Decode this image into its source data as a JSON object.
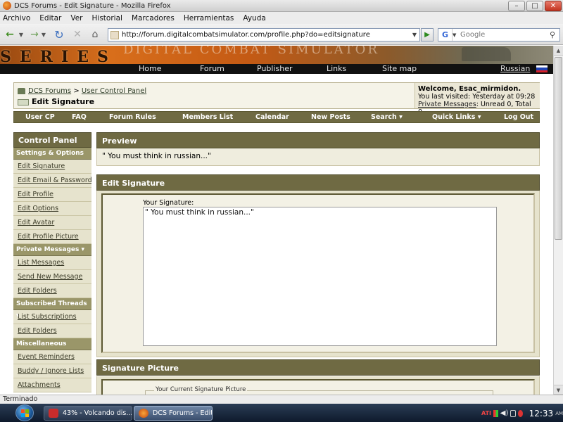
{
  "window": {
    "title": "DCS Forums - Edit Signature - Mozilla Firefox",
    "buttons": {
      "minimize": "–",
      "maximize": "□",
      "close": "✕"
    }
  },
  "menu": [
    "Archivo",
    "Editar",
    "Ver",
    "Historial",
    "Marcadores",
    "Herramientas",
    "Ayuda"
  ],
  "toolbar": {
    "url": "http://forum.digitalcombatsimulator.com/profile.php?do=editsignature",
    "search_placeholder": "Google",
    "search_engine_letter": "G",
    "icons": {
      "back": "←",
      "forward": "→",
      "reload": "↻",
      "stop": "✕",
      "home": "⌂",
      "dropdown": "▼",
      "go": "▶",
      "magnifier": "⚲"
    }
  },
  "banner": {
    "series_text": "SERIES",
    "dcs_text": "DIGITAL COMBAT SIMULATOR"
  },
  "top_nav": {
    "links": [
      "Home",
      "Forum",
      "Publisher",
      "Links",
      "Site map"
    ],
    "language": "Russian"
  },
  "breadcrumb": {
    "root": "DCS Forums",
    "separator": ">",
    "parent": "User Control Panel",
    "current": "Edit Signature"
  },
  "welcome": {
    "greeting": "Welcome, Esac_mirmidon.",
    "last_visited": "You last visited: Yesterday at 09:28",
    "pm_link": "Private Messages",
    "pm_counts": ": Unread 0, Total 0."
  },
  "nav_strip": [
    "User CP",
    "FAQ",
    "Forum Rules",
    "Members List",
    "Calendar",
    "New Posts",
    "Search ▾",
    "Quick Links ▾",
    "Log Out"
  ],
  "sidebar": {
    "title": "Control Panel",
    "sections": [
      {
        "title": "Settings & Options",
        "items": [
          "Edit Signature",
          "Edit Email & Password",
          "Edit Profile",
          "Edit Options",
          "Edit Avatar",
          "Edit Profile Picture"
        ]
      },
      {
        "title": "Private Messages ▾",
        "items": [
          "List Messages",
          "Send New Message",
          "Edit Folders"
        ]
      },
      {
        "title": "Subscribed Threads ▾",
        "items": [
          "List Subscriptions",
          "Edit Folders"
        ]
      },
      {
        "title": "Miscellaneous",
        "items": [
          "Event Reminders",
          "Buddy / Ignore Lists",
          "Attachments"
        ]
      }
    ]
  },
  "preview": {
    "title": "Preview",
    "text": "\" You must think in russian...\""
  },
  "edit_signature": {
    "title": "Edit Signature",
    "label": "Your Signature:",
    "value": "\" You must think in russian...\""
  },
  "signature_picture": {
    "title": "Signature Picture",
    "legend": "Your Current Signature Picture"
  },
  "status_bar": {
    "text": "Terminado"
  },
  "taskbar": {
    "tasks": [
      {
        "label": "43% - Volcando dis...",
        "active": false
      },
      {
        "label": "DCS Forums - Edit Si...",
        "active": true
      }
    ],
    "clock": "12:33",
    "ampm": "AM",
    "tray_icons": [
      "ati-icon",
      "shield-icon",
      "volume-icon",
      "network-icon",
      "security-icon"
    ]
  }
}
